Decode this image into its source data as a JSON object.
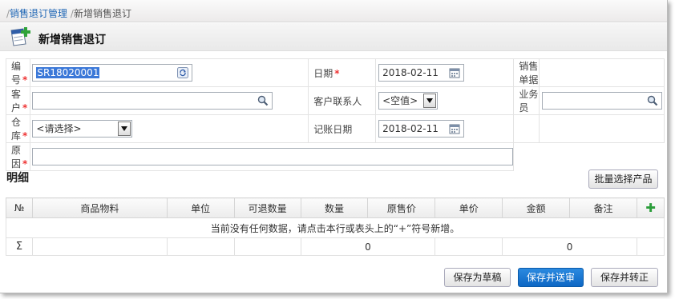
{
  "breadcrumb": {
    "sep1": "/",
    "parent": "销售退订管理",
    "sep2": "/",
    "current": "新增销售退订"
  },
  "title": "新增销售退订",
  "form": {
    "code_label": "编号",
    "code_value": "SR18020001",
    "date_label": "日期",
    "date_value": "2018-02-11",
    "sales_doc_label": "销售单据",
    "customer_label": "客户",
    "customer_value": "",
    "contact_label": "客户联系人",
    "contact_value": "<空值>",
    "salesman_label": "业务员",
    "salesman_value": "",
    "warehouse_label": "仓库",
    "warehouse_value": "<请选择>",
    "accounting_date_label": "记账日期",
    "accounting_date_value": "2018-02-11",
    "reason_label": "原因",
    "reason_value": "",
    "required_mark": "*"
  },
  "detail": {
    "title": "明细",
    "batch_button": "批量选择产品"
  },
  "grid": {
    "columns": [
      "№",
      "商品物料",
      "单位",
      "可退数量",
      "数量",
      "原售价",
      "单价",
      "金额",
      "备注"
    ],
    "empty_message": "当前没有任何数据，请点击本行或表头上的“+”符号新增。",
    "sum_symbol": "Σ",
    "sum_quantity": "0",
    "sum_amount": "0"
  },
  "buttons": {
    "save_draft": "保存为草稿",
    "save_submit": "保存并送审",
    "save_convert": "保存并转正"
  },
  "colors": {
    "link": "#1f66b5",
    "required": "#e33333",
    "primary": "#0d67c4",
    "add_icon": "#2b9d3a"
  },
  "icons": {
    "doc_add": "document-add-icon",
    "refresh": "refresh-icon",
    "calendar": "calendar-icon",
    "search": "search-icon",
    "add": "plus-icon"
  }
}
